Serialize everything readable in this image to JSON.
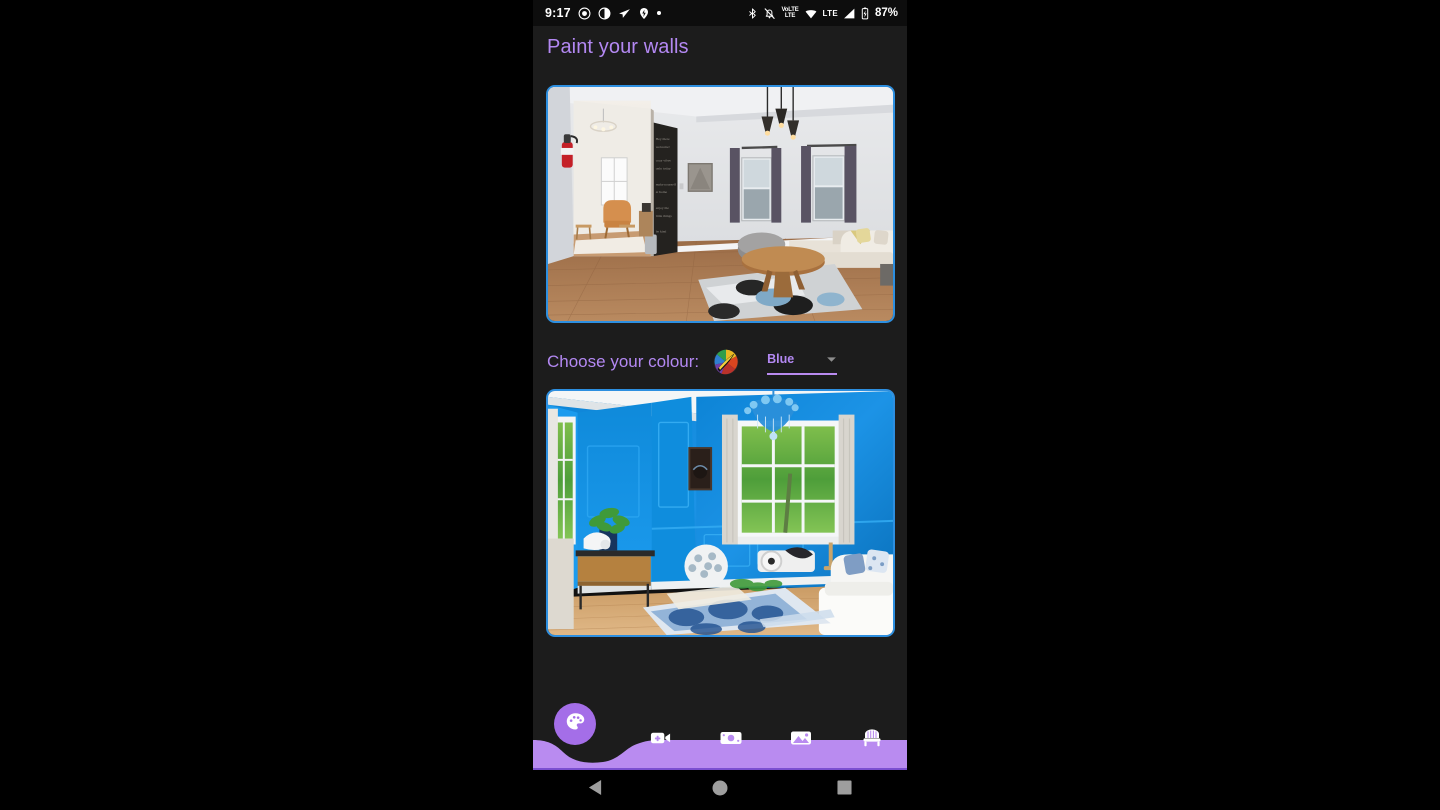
{
  "status_bar": {
    "time": "9:17",
    "left_icons": [
      "record-circle-icon",
      "brightness-contrast-icon",
      "send-paper-plane-icon",
      "location-pin-icon",
      "small-dot-icon"
    ],
    "right_icons": [
      "bluetooth-icon",
      "notifications-muted-icon",
      "volte-icon",
      "wifi-icon",
      "lte-icon",
      "signal-bars-icon",
      "battery-icon"
    ],
    "volte_top": "VoLTE",
    "volte_bottom": "LTE",
    "network_label": "LTE",
    "battery": "87%"
  },
  "page": {
    "title": "Paint your walls"
  },
  "top_photo": {
    "name": "original-room-photo",
    "alt": "Living room with white walls, hardwood floor, chalkboard wall, pendant lights and sectional sofa"
  },
  "colour_chooser": {
    "label": "Choose your colour:",
    "wheel_icon": "colour-wheel-icon",
    "selected": "Blue",
    "options": [
      "Blue"
    ],
    "arrow_icon": "chevron-down-icon"
  },
  "bottom_photo": {
    "name": "painted-room-preview",
    "alt": "Living room with bright blue painted walls, chandelier, bay window and white sofa"
  },
  "bottom_nav": {
    "fab": {
      "icon": "palette-icon",
      "name": "palette-button"
    },
    "items": [
      {
        "icon": "video-camera-add-icon",
        "name": "nav-video"
      },
      {
        "icon": "money-banknote-icon",
        "name": "nav-budget"
      },
      {
        "icon": "image-picture-icon",
        "name": "nav-gallery"
      },
      {
        "icon": "chair-furniture-icon",
        "name": "nav-furniture"
      }
    ]
  },
  "system_nav": {
    "back": "back-triangle-icon",
    "home": "home-circle-icon",
    "recents": "recents-square-icon"
  },
  "colors": {
    "accent_purple": "#b388f2",
    "nav_purple": "#b98bf0",
    "fab_purple": "#a46ee8",
    "photo_border": "#2d8fe0",
    "screen_bg": "#1c1c1c"
  }
}
